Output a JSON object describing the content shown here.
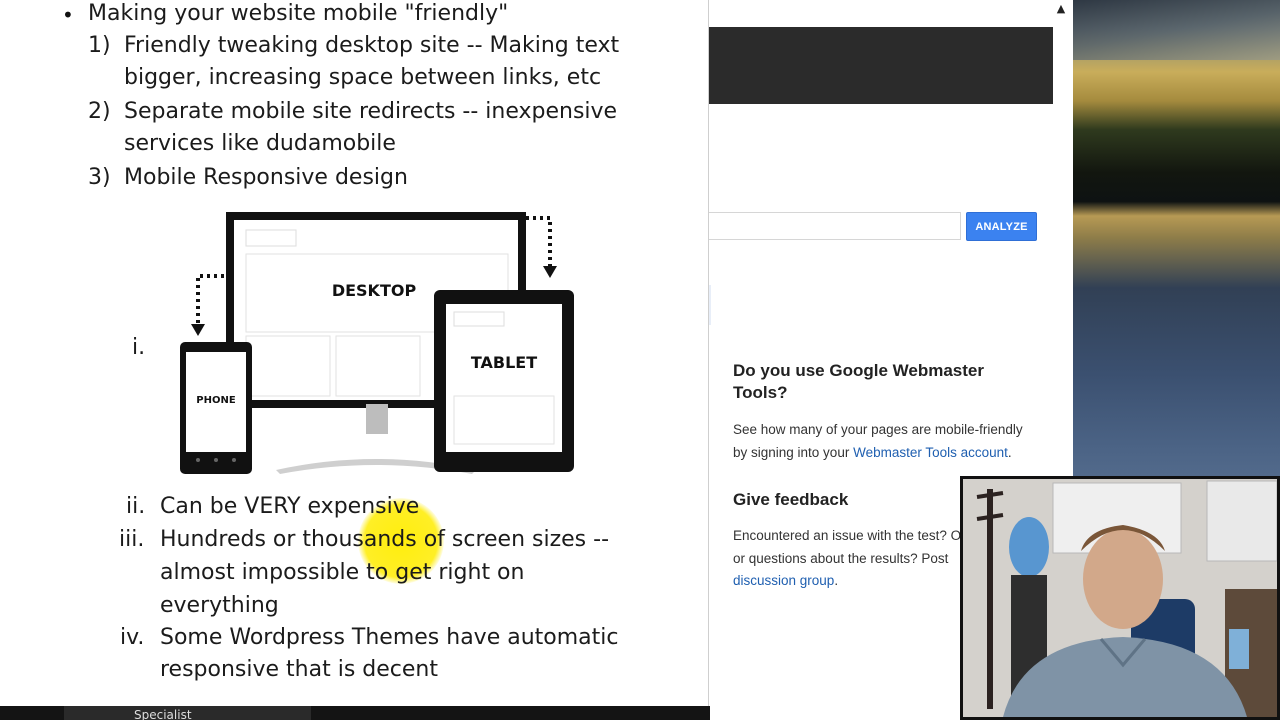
{
  "slide": {
    "bullet_symbol": "•",
    "bullet_text": "Making your website mobile \"friendly\"",
    "items": [
      {
        "num": "1)",
        "lines": [
          "Friendly tweaking desktop site -- Making text",
          "bigger, increasing space between links, etc"
        ]
      },
      {
        "num": "2)",
        "lines": [
          "Separate mobile site redirects -- inexpensive",
          "services like dudamobile"
        ]
      },
      {
        "num": "3)",
        "lines": [
          "Mobile Responsive design"
        ]
      }
    ],
    "sub_items": [
      {
        "num": "i.",
        "lines": []
      },
      {
        "num": "ii.",
        "lines": [
          "Can be VERY expensive"
        ]
      },
      {
        "num": "iii.",
        "lines": [
          "Hundreds or thousands of screen sizes --",
          "almost impossible to get right on",
          "everything"
        ]
      },
      {
        "num": "iv.",
        "lines": [
          "Some Wordpress Themes have automatic",
          "responsive that is decent"
        ]
      }
    ],
    "devices": {
      "desktop_label": "DESKTOP",
      "tablet_label": "TABLET",
      "phone_label": "PHONE"
    }
  },
  "browser": {
    "scroll_up_glyph": "▲",
    "url_value": "",
    "analyze_label": "ANALYZE",
    "webmaster": {
      "heading_line1": "Do you use Google Webmaster",
      "heading_line2": "Tools?",
      "text_line1": "See how many of your pages are mobile-friendly",
      "text_line2_prefix": "by signing into your ",
      "link": "Webmaster Tools account",
      "text_line2_suffix": "."
    },
    "feedback": {
      "heading": "Give feedback",
      "text_line1": "Encountered an issue with the test? O",
      "text_line2": "or questions about the results? Post",
      "link": "discussion group",
      "link_suffix": "."
    }
  },
  "taskbar": {
    "item_label": "Specialist"
  },
  "colors": {
    "analyze_blue": "#3b82f0",
    "link_blue": "#1f5fb0",
    "highlight_yellow": "#ffec00"
  }
}
